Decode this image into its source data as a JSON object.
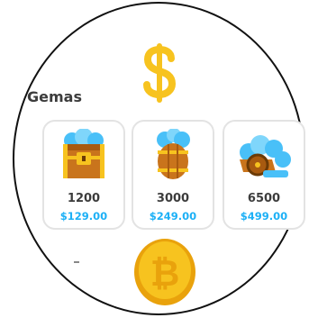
{
  "section": {
    "title": "Gemas"
  },
  "icons": {
    "header": "dollar-sign-icon",
    "coin": "bitcoin-coin-icon",
    "packs": [
      "treasure-chest-gems-icon",
      "barrel-gems-icon",
      "cart-gems-icon"
    ]
  },
  "colors": {
    "gold": "#f7c31f",
    "gem": "#49c0f8",
    "price": "#1cb0f6",
    "text": "#3c3c3c",
    "border": "#e3e3e3"
  },
  "packs": [
    {
      "amount": "1200",
      "price": "$129.00"
    },
    {
      "amount": "3000",
      "price": "$249.00"
    },
    {
      "amount": "6500",
      "price": "$499.00"
    }
  ]
}
